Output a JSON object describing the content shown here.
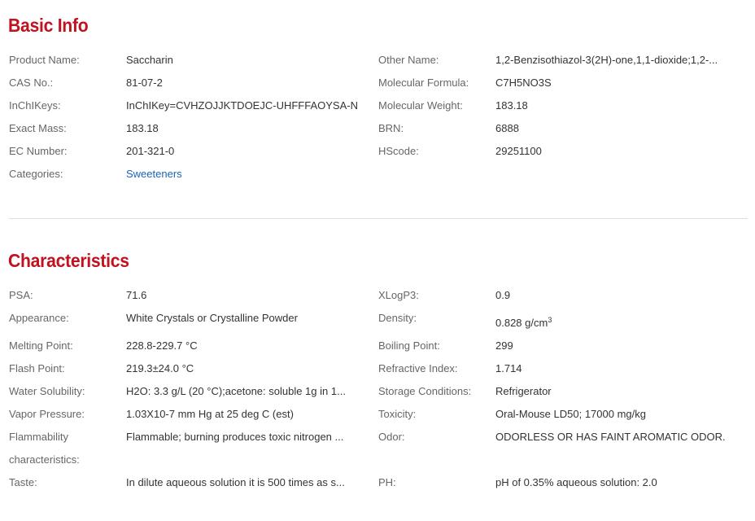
{
  "basic_info": {
    "title": "Basic Info",
    "rows": [
      {
        "l1": "Product Name:",
        "v1": "Saccharin",
        "l2": "Other Name:",
        "v2": "1,2-Benzisothiazol-3(2H)-one,1,1-dioxide;1,2-..."
      },
      {
        "l1": "CAS No.:",
        "v1": "81-07-2",
        "l2": "Molecular Formula:",
        "v2": "C7H5NO3S"
      },
      {
        "l1": "InChIKeys:",
        "v1": "InChIKey=CVHZOJJKTDOEJC-UHFFFAOYSA-N",
        "l2": "Molecular Weight:",
        "v2": "183.18"
      },
      {
        "l1": "Exact Mass:",
        "v1": "183.18",
        "l2": "BRN:",
        "v2": "6888"
      },
      {
        "l1": "EC Number:",
        "v1": "201-321-0",
        "l2": "HScode:",
        "v2": "29251100"
      },
      {
        "l1": "Categories:",
        "v1": "Sweeteners"
      }
    ]
  },
  "characteristics": {
    "title": "Characteristics",
    "rows": [
      {
        "l1": "PSA:",
        "v1": "71.6",
        "l2": "XLogP3:",
        "v2": "0.9"
      },
      {
        "l1": "Appearance:",
        "v1": "White Crystals or Crystalline Powder",
        "l2": "Density:",
        "v2": "0.828 g/cm",
        "v2_sup": "3"
      },
      {
        "l1": "Melting Point:",
        "v1": "228.8-229.7 °C",
        "l2": "Boiling Point:",
        "v2": "299"
      },
      {
        "l1": "Flash Point:",
        "v1": "219.3±24.0 °C",
        "l2": "Refractive Index:",
        "v2": "1.714"
      },
      {
        "l1": "Water Solubility:",
        "v1": "H2O: 3.3 g/L (20 °C);acetone: soluble 1g in 1...",
        "l2": "Storage Conditions:",
        "v2": "Refrigerator"
      },
      {
        "l1": "Vapor Pressure:",
        "v1": "1.03X10-7 mm Hg at 25 deg C (est)",
        "l2": "Toxicity:",
        "v2": "Oral-Mouse LD50; 17000 mg/kg"
      },
      {
        "l1": "Flammability characteristics:",
        "v1": "Flammable; burning produces toxic nitrogen ...",
        "l2": "Odor:",
        "v2": "ODORLESS OR HAS FAINT AROMATIC ODOR."
      },
      {
        "l1": "Taste:",
        "v1": "In dilute aqueous solution it is 500 times as s...",
        "l2": "PH:",
        "v2": "pH of 0.35% aqueous solution: 2.0"
      }
    ]
  }
}
